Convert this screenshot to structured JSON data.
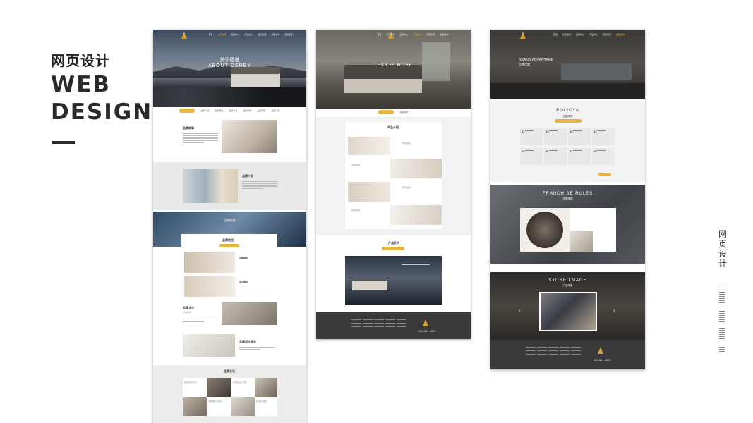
{
  "heading": {
    "cn": "网页设计",
    "en_line1": "WEB",
    "en_line2": "DESIGN"
  },
  "side_label": "网页设计",
  "mockup1": {
    "hero_cn": "关于德曼",
    "hero_en": "ABOUT DERBY",
    "sections": {
      "s1_title": "品牌故事",
      "s2_title": "品牌介绍",
      "band_title": "品牌愿景",
      "s3_title": "品牌定位",
      "s3_item1": "品牌理念",
      "s3_item2": "设计理念",
      "s4_title": "品牌文化",
      "s4_sub": "人居空间",
      "s5_title": "品牌设计理念",
      "s6_title": "品牌文化"
    },
    "tiles": [
      "智造你居住空间",
      "专业家居设计定制",
      "全屋智能产品升级",
      "舒适舒心家居"
    ]
  },
  "mockup2": {
    "hero_en": "LESS IS MORE",
    "panel1_title": "产品介绍",
    "panel1_items": [
      "现代简约",
      "北欧风格",
      "现代极简",
      "轻奢风格"
    ],
    "panel2_title": "产品系列",
    "phone": "400-611-0899"
  },
  "mockup3": {
    "hero_en": "BRAND ADVANTAGE",
    "hero_cn": "品牌优势",
    "policy_en": "POLICYA",
    "policy_cn": "加盟政策",
    "grid_nums": [
      "01",
      "02",
      "03",
      "04",
      "05",
      "06",
      "07",
      "08"
    ],
    "franchise_en": "FRANCHISE RULES",
    "franchise_cn": "加盟规则",
    "store_en": "STORE LMAGE",
    "store_cn": "门店形象",
    "phone": "400-611-0899"
  },
  "colors": {
    "accent": "#e4b640",
    "dark": "#3a3a3a"
  }
}
